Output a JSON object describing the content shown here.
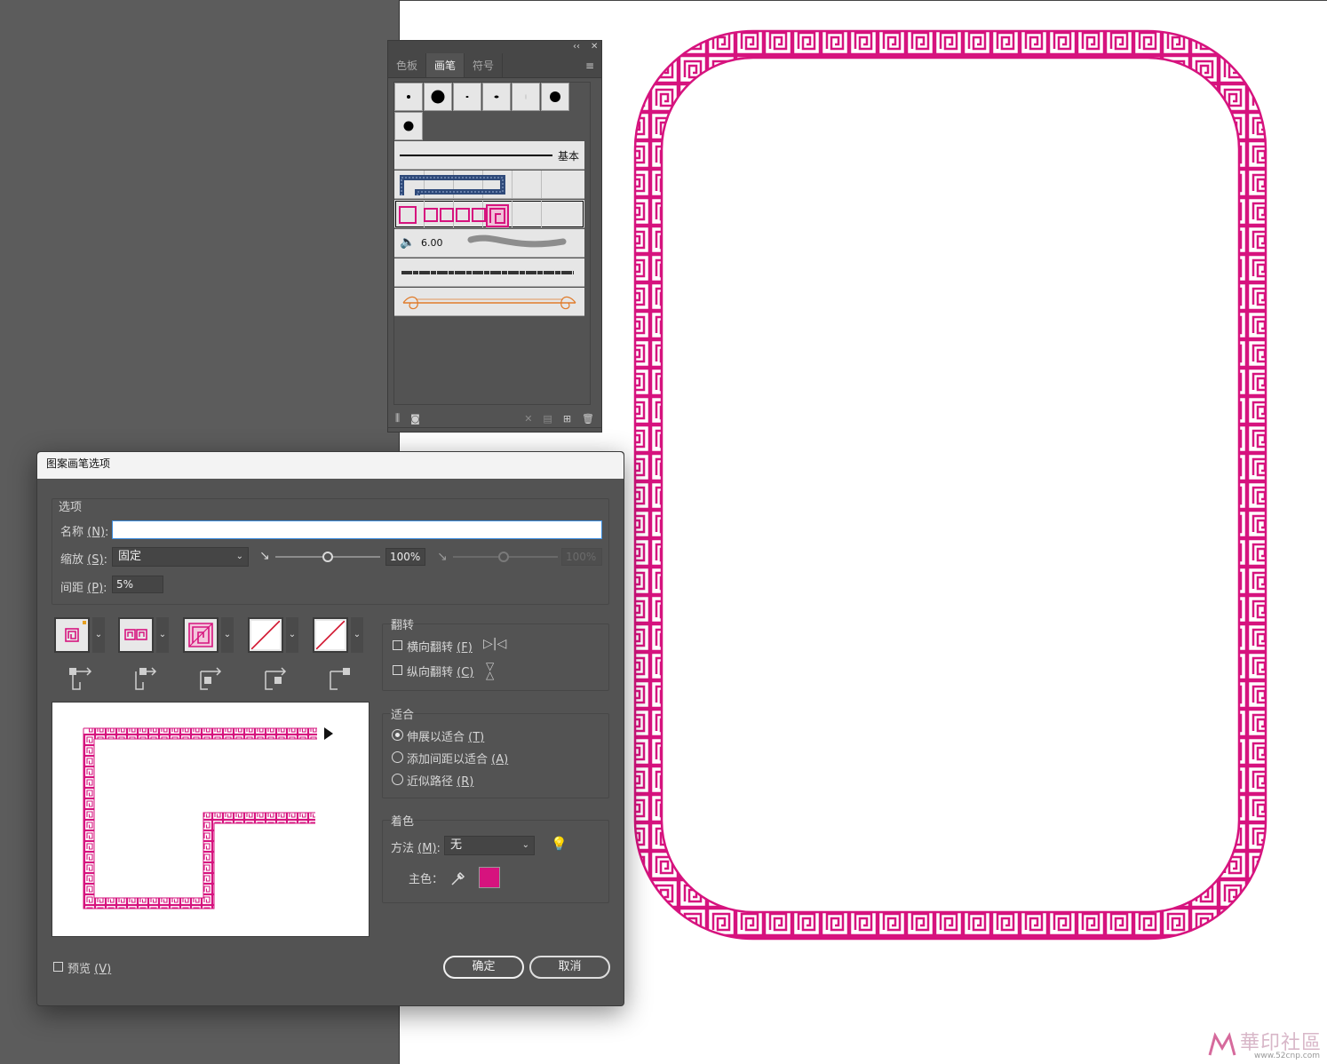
{
  "brush_panel": {
    "tabs": [
      "色板",
      "画笔",
      "符号"
    ],
    "active_tab": "画笔",
    "basic_label": "基本",
    "size_value": "6.00"
  },
  "dialog": {
    "title": "图案画笔选项",
    "options_group": "选项",
    "name_label": "名称",
    "name_key": "(N)",
    "name_value": "",
    "scale_label": "缩放",
    "scale_key": "(S)",
    "scale_select": "固定",
    "scale_value": "100%",
    "scale_value2": "100%",
    "spacing_label": "间距",
    "spacing_key": "(P)",
    "spacing_value": "5%",
    "flip_group": "翻转",
    "flip_h_label": "横向翻转",
    "flip_h_key": "(F)",
    "flip_v_label": "纵向翻转",
    "flip_v_key": "(C)",
    "fit_group": "适合",
    "fit_options": [
      {
        "label": "伸展以适合",
        "key": "(T)",
        "selected": true
      },
      {
        "label": "添加间距以适合",
        "key": "(A)",
        "selected": false
      },
      {
        "label": "近似路径",
        "key": "(R)",
        "selected": false
      }
    ],
    "color_group": "着色",
    "method_label": "方法",
    "method_key": "(M)",
    "method_value": "无",
    "key_color_label": "主色：",
    "key_color": "#d6137e",
    "preview_label": "预览",
    "preview_key": "(V)",
    "ok_label": "确定",
    "cancel_label": "取消"
  },
  "watermark": {
    "main": "華印社區",
    "sub": "www.52cnp.com"
  },
  "colors": {
    "pattern": "#d6137e",
    "panel_bg": "#535353",
    "workspace": "#5c5c5c"
  }
}
